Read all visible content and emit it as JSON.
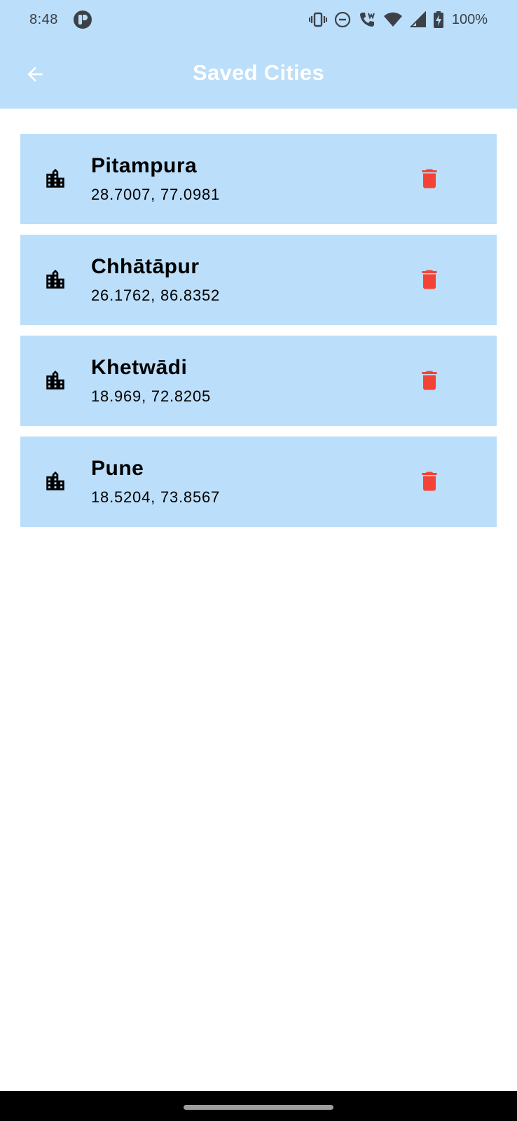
{
  "status_bar": {
    "time": "8:48",
    "battery": "100%",
    "icons": [
      "app-notification-icon",
      "vibrate-icon",
      "do-not-disturb-icon",
      "wifi-calling-icon",
      "wifi-icon",
      "cell-signal-icon",
      "battery-charging-icon"
    ]
  },
  "app_bar": {
    "title": "Saved Cities",
    "back_icon": "arrow-back-icon"
  },
  "cities": [
    {
      "name": "Pitampura",
      "coords": "28.7007, 77.0981"
    },
    {
      "name": "Chhātāpur",
      "coords": "26.1762, 86.8352"
    },
    {
      "name": "Khetwādi",
      "coords": "18.969, 72.8205"
    },
    {
      "name": "Pune",
      "coords": "18.5204, 73.8567"
    }
  ],
  "colors": {
    "primary_light": "#bbdefa",
    "delete": "#f44336",
    "title_text": "#ffffff"
  }
}
